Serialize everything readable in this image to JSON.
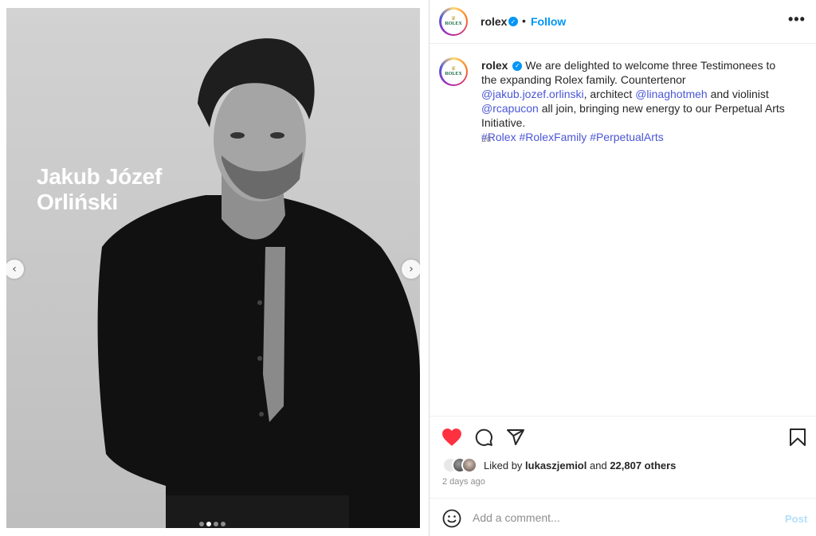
{
  "media": {
    "overlay_name_line1": "Jakub Józef",
    "overlay_name_line2": "Orliński",
    "prev_icon": "chevron-left-icon",
    "next_icon": "chevron-right-icon",
    "slide_count": 4,
    "active_slide": 2
  },
  "header": {
    "username": "rolex",
    "verified_icon": "verified-badge-icon",
    "separator": "•",
    "follow_label": "Follow",
    "more_icon": "more-options-icon",
    "avatar_logo_text": "ROLEX",
    "avatar_crown": "♛"
  },
  "caption": {
    "username": "rolex",
    "text_part1": "We are delighted to welcome three Testimonees to the expanding Rolex family. Countertenor ",
    "mention1": "@jakub.jozef.orlinski",
    "text_part2": ", architect ",
    "mention2": "@linaghotmeh",
    "text_part3": " and violinist ",
    "mention3": "@rcapucon",
    "text_part4": " all join, bringing new energy to our Perpetual Arts Initiative.",
    "hashtag1": "#Rolex",
    "hashtag2": "#RolexFamily",
    "hashtag3": "#PerpetualArts",
    "time": "2d"
  },
  "actions": {
    "like_icon": "heart-filled-icon",
    "comment_icon": "comment-icon",
    "share_icon": "share-icon",
    "save_icon": "bookmark-icon"
  },
  "likes": {
    "prefix": "Liked by",
    "user": "lukaszjemiol",
    "middle": "and",
    "count": "22,807 others"
  },
  "date": "2 days ago",
  "comment": {
    "emoji_icon": "emoji-icon",
    "placeholder": "Add a comment...",
    "post_label": "Post"
  },
  "colors": {
    "accent": "#0095f6",
    "like": "#ff3040",
    "link": "#4a56d6",
    "post_disabled": "#b2dffc"
  }
}
